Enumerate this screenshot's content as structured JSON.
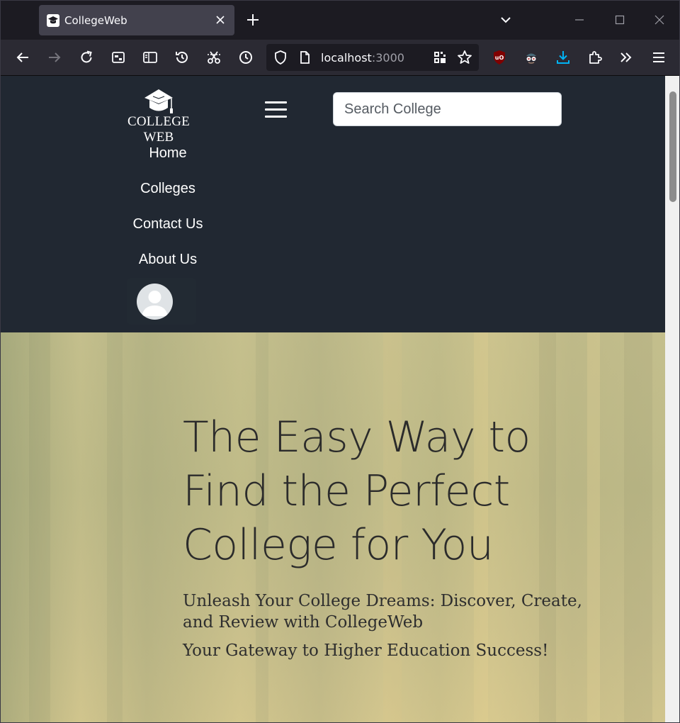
{
  "browser": {
    "tab": {
      "title": "CollegeWeb",
      "favicon": "graduation-cap-icon"
    },
    "url": {
      "host": "localhost",
      "port": ":3000"
    }
  },
  "site": {
    "logo_text": "COLLEGE WEB",
    "search": {
      "placeholder": "Search College",
      "value": ""
    },
    "nav": [
      {
        "label": "Home"
      },
      {
        "label": "Colleges"
      },
      {
        "label": "Contact Us"
      },
      {
        "label": "About Us"
      }
    ]
  },
  "hero": {
    "title": "The Easy Way to Find the Perfect College for You",
    "subtitle": "Unleash Your College Dreams: Discover, Create, and Review with CollegeWeb",
    "tagline": "Your Gateway to Higher Education Success!"
  },
  "colors": {
    "header_bg": "#212832",
    "accent_download": "#00b3f4",
    "ublock_red": "#800000"
  }
}
